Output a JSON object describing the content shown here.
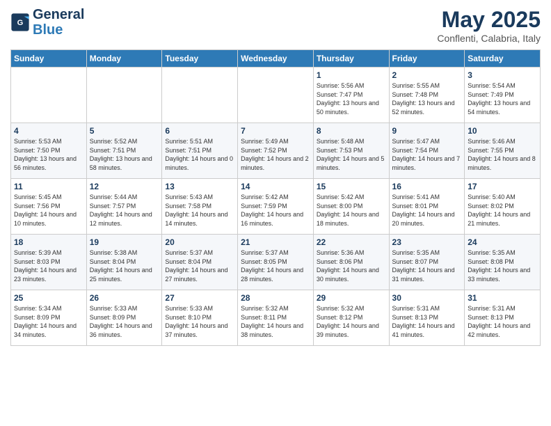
{
  "logo": {
    "line1": "General",
    "line2": "Blue"
  },
  "title": "May 2025",
  "subtitle": "Conflenti, Calabria, Italy",
  "weekdays": [
    "Sunday",
    "Monday",
    "Tuesday",
    "Wednesday",
    "Thursday",
    "Friday",
    "Saturday"
  ],
  "weeks": [
    [
      {
        "day": "",
        "sunrise": "",
        "sunset": "",
        "daylight": ""
      },
      {
        "day": "",
        "sunrise": "",
        "sunset": "",
        "daylight": ""
      },
      {
        "day": "",
        "sunrise": "",
        "sunset": "",
        "daylight": ""
      },
      {
        "day": "",
        "sunrise": "",
        "sunset": "",
        "daylight": ""
      },
      {
        "day": "1",
        "sunrise": "Sunrise: 5:56 AM",
        "sunset": "Sunset: 7:47 PM",
        "daylight": "Daylight: 13 hours and 50 minutes."
      },
      {
        "day": "2",
        "sunrise": "Sunrise: 5:55 AM",
        "sunset": "Sunset: 7:48 PM",
        "daylight": "Daylight: 13 hours and 52 minutes."
      },
      {
        "day": "3",
        "sunrise": "Sunrise: 5:54 AM",
        "sunset": "Sunset: 7:49 PM",
        "daylight": "Daylight: 13 hours and 54 minutes."
      }
    ],
    [
      {
        "day": "4",
        "sunrise": "Sunrise: 5:53 AM",
        "sunset": "Sunset: 7:50 PM",
        "daylight": "Daylight: 13 hours and 56 minutes."
      },
      {
        "day": "5",
        "sunrise": "Sunrise: 5:52 AM",
        "sunset": "Sunset: 7:51 PM",
        "daylight": "Daylight: 13 hours and 58 minutes."
      },
      {
        "day": "6",
        "sunrise": "Sunrise: 5:51 AM",
        "sunset": "Sunset: 7:51 PM",
        "daylight": "Daylight: 14 hours and 0 minutes."
      },
      {
        "day": "7",
        "sunrise": "Sunrise: 5:49 AM",
        "sunset": "Sunset: 7:52 PM",
        "daylight": "Daylight: 14 hours and 2 minutes."
      },
      {
        "day": "8",
        "sunrise": "Sunrise: 5:48 AM",
        "sunset": "Sunset: 7:53 PM",
        "daylight": "Daylight: 14 hours and 5 minutes."
      },
      {
        "day": "9",
        "sunrise": "Sunrise: 5:47 AM",
        "sunset": "Sunset: 7:54 PM",
        "daylight": "Daylight: 14 hours and 7 minutes."
      },
      {
        "day": "10",
        "sunrise": "Sunrise: 5:46 AM",
        "sunset": "Sunset: 7:55 PM",
        "daylight": "Daylight: 14 hours and 8 minutes."
      }
    ],
    [
      {
        "day": "11",
        "sunrise": "Sunrise: 5:45 AM",
        "sunset": "Sunset: 7:56 PM",
        "daylight": "Daylight: 14 hours and 10 minutes."
      },
      {
        "day": "12",
        "sunrise": "Sunrise: 5:44 AM",
        "sunset": "Sunset: 7:57 PM",
        "daylight": "Daylight: 14 hours and 12 minutes."
      },
      {
        "day": "13",
        "sunrise": "Sunrise: 5:43 AM",
        "sunset": "Sunset: 7:58 PM",
        "daylight": "Daylight: 14 hours and 14 minutes."
      },
      {
        "day": "14",
        "sunrise": "Sunrise: 5:42 AM",
        "sunset": "Sunset: 7:59 PM",
        "daylight": "Daylight: 14 hours and 16 minutes."
      },
      {
        "day": "15",
        "sunrise": "Sunrise: 5:42 AM",
        "sunset": "Sunset: 8:00 PM",
        "daylight": "Daylight: 14 hours and 18 minutes."
      },
      {
        "day": "16",
        "sunrise": "Sunrise: 5:41 AM",
        "sunset": "Sunset: 8:01 PM",
        "daylight": "Daylight: 14 hours and 20 minutes."
      },
      {
        "day": "17",
        "sunrise": "Sunrise: 5:40 AM",
        "sunset": "Sunset: 8:02 PM",
        "daylight": "Daylight: 14 hours and 21 minutes."
      }
    ],
    [
      {
        "day": "18",
        "sunrise": "Sunrise: 5:39 AM",
        "sunset": "Sunset: 8:03 PM",
        "daylight": "Daylight: 14 hours and 23 minutes."
      },
      {
        "day": "19",
        "sunrise": "Sunrise: 5:38 AM",
        "sunset": "Sunset: 8:04 PM",
        "daylight": "Daylight: 14 hours and 25 minutes."
      },
      {
        "day": "20",
        "sunrise": "Sunrise: 5:37 AM",
        "sunset": "Sunset: 8:04 PM",
        "daylight": "Daylight: 14 hours and 27 minutes."
      },
      {
        "day": "21",
        "sunrise": "Sunrise: 5:37 AM",
        "sunset": "Sunset: 8:05 PM",
        "daylight": "Daylight: 14 hours and 28 minutes."
      },
      {
        "day": "22",
        "sunrise": "Sunrise: 5:36 AM",
        "sunset": "Sunset: 8:06 PM",
        "daylight": "Daylight: 14 hours and 30 minutes."
      },
      {
        "day": "23",
        "sunrise": "Sunrise: 5:35 AM",
        "sunset": "Sunset: 8:07 PM",
        "daylight": "Daylight: 14 hours and 31 minutes."
      },
      {
        "day": "24",
        "sunrise": "Sunrise: 5:35 AM",
        "sunset": "Sunset: 8:08 PM",
        "daylight": "Daylight: 14 hours and 33 minutes."
      }
    ],
    [
      {
        "day": "25",
        "sunrise": "Sunrise: 5:34 AM",
        "sunset": "Sunset: 8:09 PM",
        "daylight": "Daylight: 14 hours and 34 minutes."
      },
      {
        "day": "26",
        "sunrise": "Sunrise: 5:33 AM",
        "sunset": "Sunset: 8:09 PM",
        "daylight": "Daylight: 14 hours and 36 minutes."
      },
      {
        "day": "27",
        "sunrise": "Sunrise: 5:33 AM",
        "sunset": "Sunset: 8:10 PM",
        "daylight": "Daylight: 14 hours and 37 minutes."
      },
      {
        "day": "28",
        "sunrise": "Sunrise: 5:32 AM",
        "sunset": "Sunset: 8:11 PM",
        "daylight": "Daylight: 14 hours and 38 minutes."
      },
      {
        "day": "29",
        "sunrise": "Sunrise: 5:32 AM",
        "sunset": "Sunset: 8:12 PM",
        "daylight": "Daylight: 14 hours and 39 minutes."
      },
      {
        "day": "30",
        "sunrise": "Sunrise: 5:31 AM",
        "sunset": "Sunset: 8:13 PM",
        "daylight": "Daylight: 14 hours and 41 minutes."
      },
      {
        "day": "31",
        "sunrise": "Sunrise: 5:31 AM",
        "sunset": "Sunset: 8:13 PM",
        "daylight": "Daylight: 14 hours and 42 minutes."
      }
    ]
  ]
}
